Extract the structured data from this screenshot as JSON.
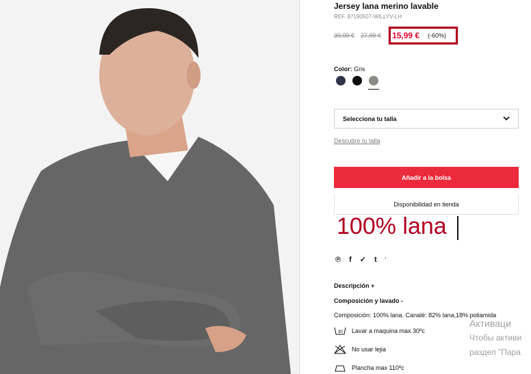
{
  "product": {
    "title": "Jersey lana merino lavable",
    "reference": "REF. 87190507-WILLYV-LH",
    "prices": {
      "original": "39,99 €",
      "previous": "27,99 €",
      "sale": "15,99 €",
      "discount": "(-60%)"
    },
    "color": {
      "label": "Color:",
      "selected": "Gris",
      "swatches": [
        {
          "name": "navy",
          "hex": "#2f3448"
        },
        {
          "name": "black",
          "hex": "#0d0d0d"
        },
        {
          "name": "grey",
          "hex": "#8c8a86"
        }
      ]
    },
    "size_select_placeholder": "Selecciona tu talla",
    "size_guide_link": "Descubre tu talla",
    "add_to_bag": "Añadir a la bolsa",
    "store_availability": "Disponibilidad en tienda",
    "overlay_text": "100% lana",
    "share_icons": [
      "pinterest-icon",
      "facebook-icon",
      "twitter-icon",
      "tumblr-icon"
    ],
    "description_heading": "Descripción +",
    "composition_heading": "Composición y lavado -",
    "composition_text": "Composición: 100% lana. Canalé: 82% lana,18% poliamida",
    "care": [
      {
        "icon": "wash-30-icon",
        "text": "Lavar a maquina max 30ºc"
      },
      {
        "icon": "no-bleach-icon",
        "text": "No usar lejia"
      },
      {
        "icon": "iron-icon",
        "text": "Plancha max 110ºc"
      }
    ]
  },
  "windows_watermark": {
    "line1": "Активаци",
    "line2": "Чтобы активи",
    "line3": "раздел \"Пара"
  },
  "colors": {
    "accent_red": "#eb2a3b",
    "price_red": "#e4002b",
    "highlight_border": "#b1001f"
  }
}
